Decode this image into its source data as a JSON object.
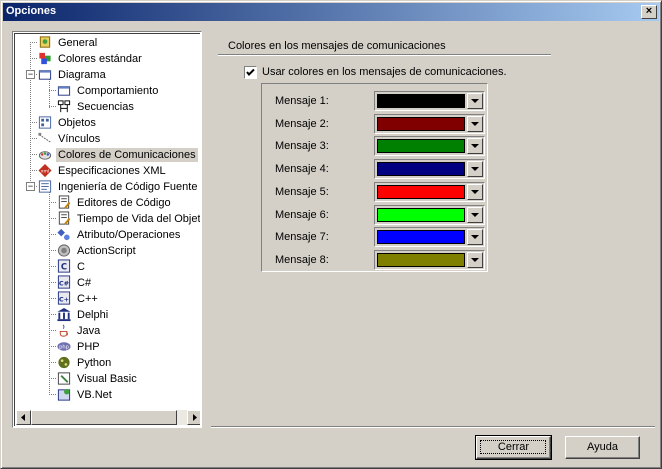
{
  "window": {
    "title": "Opciones",
    "close_glyph": "×"
  },
  "tree": {
    "items": [
      {
        "label": "General",
        "icon": "general-icon"
      },
      {
        "label": "Colores estándar",
        "icon": "colors-icon"
      },
      {
        "label": "Diagrama",
        "icon": "diagram-icon",
        "expander": "−"
      },
      {
        "label": "Comportamiento",
        "icon": "behavior-icon"
      },
      {
        "label": "Secuencias",
        "icon": "sequence-icon"
      },
      {
        "label": "Objetos",
        "icon": "objects-icon"
      },
      {
        "label": "Vínculos",
        "icon": "links-icon"
      },
      {
        "label": "Colores de Comunicaciones",
        "icon": "communication-colors-icon",
        "selected": true
      },
      {
        "label": "Especificaciones XML",
        "icon": "xml-icon"
      },
      {
        "label": "Ingeniería de Código Fuente",
        "icon": "source-code-icon",
        "expander": "−"
      },
      {
        "label": "Editores de Código",
        "icon": "code-editor-icon"
      },
      {
        "label": "Tiempo de Vida del Objeto",
        "icon": "object-lifetime-icon"
      },
      {
        "label": "Atributo/Operaciones",
        "icon": "attribute-operations-icon"
      },
      {
        "label": "ActionScript",
        "icon": "actionscript-icon"
      },
      {
        "label": "C",
        "icon": "c-icon"
      },
      {
        "label": "C#",
        "icon": "csharp-icon"
      },
      {
        "label": "C++",
        "icon": "cpp-icon"
      },
      {
        "label": "Delphi",
        "icon": "delphi-icon"
      },
      {
        "label": "Java",
        "icon": "java-icon"
      },
      {
        "label": "PHP",
        "icon": "php-icon"
      },
      {
        "label": "Python",
        "icon": "python-icon"
      },
      {
        "label": "Visual Basic",
        "icon": "visual-basic-icon"
      },
      {
        "label": "VB.Net",
        "icon": "vbnet-icon"
      }
    ]
  },
  "panel": {
    "title": "Colores en los mensajes de comunicaciones",
    "checkbox_label": "Usar colores en los mensajes de comunicaciones.",
    "checkbox_checked": true,
    "messages": [
      {
        "label": "Mensaje 1:",
        "color": "#000000"
      },
      {
        "label": "Mensaje 2:",
        "color": "#800000"
      },
      {
        "label": "Mensaje 3:",
        "color": "#008000"
      },
      {
        "label": "Mensaje 4:",
        "color": "#000080"
      },
      {
        "label": "Mensaje 5:",
        "color": "#ff0000"
      },
      {
        "label": "Mensaje 6:",
        "color": "#00ff00"
      },
      {
        "label": "Mensaje 7:",
        "color": "#0000ff"
      },
      {
        "label": "Mensaje 8:",
        "color": "#808000"
      }
    ]
  },
  "buttons": {
    "close": "Cerrar",
    "help": "Ayuda"
  }
}
